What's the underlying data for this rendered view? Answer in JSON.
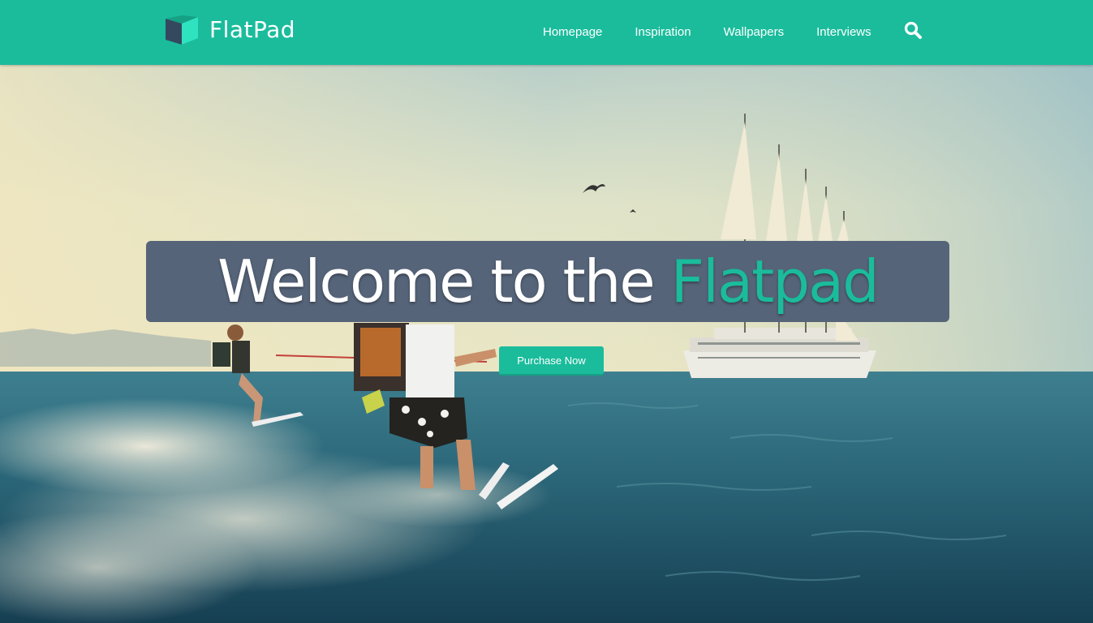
{
  "brand": {
    "name": "FlatPad",
    "icon": "cube-logo-icon",
    "colors": {
      "accent": "#1abc9c",
      "cube_dark": "#34495e",
      "cube_light": "#2fe3c1"
    }
  },
  "nav": {
    "items": [
      {
        "label": "Homepage"
      },
      {
        "label": "Inspiration"
      },
      {
        "label": "Wallpapers"
      },
      {
        "label": "Interviews"
      }
    ],
    "search_icon": "search-icon"
  },
  "hero": {
    "title_main": "Welcome to the ",
    "title_accent": "Flatpad",
    "cta_label": "Purchase Now",
    "background_image": "water skiers towed by a sailing cruise ship on the open sea",
    "colors": {
      "navbar": "#1abc9c",
      "title_box": "#566479",
      "title_accent": "#1abc9c"
    }
  }
}
